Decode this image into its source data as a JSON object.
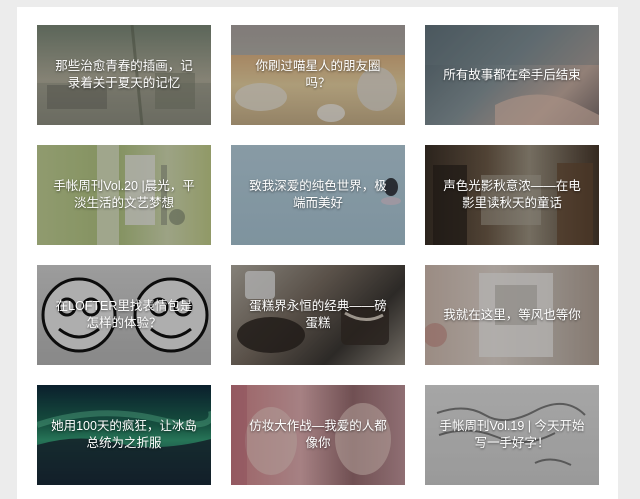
{
  "cards": [
    {
      "caption": "那些治愈青春的插画，记录着关于夏天的记忆"
    },
    {
      "caption": "你刷过喵星人的朋友圈吗？"
    },
    {
      "caption": "所有故事都在牵手后结束"
    },
    {
      "caption": "手帐周刊Vol.20 |晨光，平淡生活的文艺梦想"
    },
    {
      "caption": "致我深爱的纯色世界，极端而美好"
    },
    {
      "caption": "声色光影秋意浓——在电影里读秋天的童话"
    },
    {
      "caption": "在LOFTER里找表情包是怎样的体验？"
    },
    {
      "caption": "蛋糕界永恒的经典——磅蛋糕"
    },
    {
      "caption": "我就在这里，等风也等你"
    },
    {
      "caption": "她用100天的疯狂，让冰岛总统为之折服"
    },
    {
      "caption": "仿妆大作战—我爱的人都像你"
    },
    {
      "caption": "手帐周刊Vol.19 | 今天开始写一手好字！"
    }
  ]
}
